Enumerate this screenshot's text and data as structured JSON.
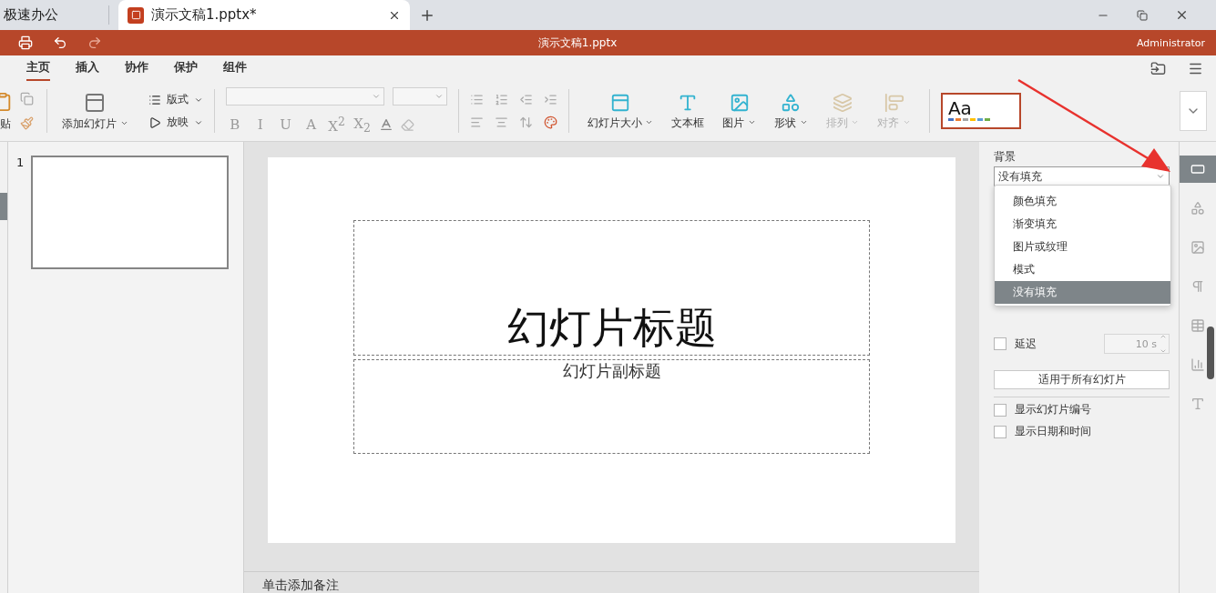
{
  "tabs": [
    {
      "label": "极速办公",
      "selected": false
    },
    {
      "label": "演示文稿1.pptx*",
      "selected": true
    }
  ],
  "title_bar": {
    "title": "演示文稿1.pptx",
    "user": "Administrator"
  },
  "menu": [
    {
      "label": "主页",
      "selected": true
    },
    {
      "label": "插入",
      "selected": false
    },
    {
      "label": "协作",
      "selected": false
    },
    {
      "label": "保护",
      "selected": false
    },
    {
      "label": "组件",
      "selected": false
    }
  ],
  "ribbon": {
    "paste_label": "贴",
    "add_slide": "添加幻灯片",
    "layout": "版式",
    "play": "放映",
    "format_buttons": [
      "B",
      "I",
      "U",
      "A",
      "X$^{2}$",
      "X$_{2}$"
    ],
    "insert_tools": [
      {
        "kind": "size",
        "label": "幻灯片大小",
        "caret": true,
        "disabled": false
      },
      {
        "kind": "textbox",
        "label": "文本框",
        "caret": false,
        "disabled": false
      },
      {
        "kind": "image",
        "label": "图片",
        "caret": true,
        "disabled": false
      },
      {
        "kind": "shape",
        "label": "形状",
        "caret": true,
        "disabled": false
      },
      {
        "kind": "arrange",
        "label": "排列",
        "caret": true,
        "disabled": true
      },
      {
        "kind": "align",
        "label": "对齐",
        "caret": true,
        "disabled": true
      }
    ],
    "theme_preview": "Aa"
  },
  "thumbnails": [
    {
      "number": "1",
      "selected": true
    }
  ],
  "slide": {
    "title": "幻灯片标题",
    "subtitle": "幻灯片副标题"
  },
  "notes": {
    "placeholder": "单击添加备注"
  },
  "panel": {
    "background_label": "背景",
    "fill_value": "没有填充",
    "fill_options": [
      {
        "label": "颜色填充",
        "selected": false
      },
      {
        "label": "渐变填充",
        "selected": false
      },
      {
        "label": "图片或纹理",
        "selected": false
      },
      {
        "label": "模式",
        "selected": false
      },
      {
        "label": "没有填充",
        "selected": true
      }
    ],
    "delay": {
      "label": "延迟",
      "checked": false,
      "value": "10 s"
    },
    "apply_all": "适用于所有幻灯片",
    "options": [
      {
        "label": "显示幻灯片编号",
        "checked": false
      },
      {
        "label": "显示日期和时间",
        "checked": false
      }
    ]
  },
  "rail": [
    {
      "kind": "slide",
      "selected": true
    },
    {
      "kind": "shape",
      "selected": false
    },
    {
      "kind": "image",
      "selected": false
    },
    {
      "kind": "paragraph",
      "selected": false
    },
    {
      "kind": "table",
      "selected": false
    },
    {
      "kind": "chart",
      "selected": false
    },
    {
      "kind": "textart",
      "selected": false
    }
  ]
}
